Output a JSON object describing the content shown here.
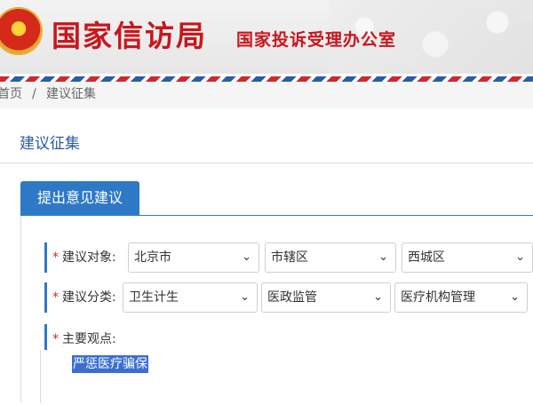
{
  "header": {
    "title": "国家信访局",
    "subtitle": "国家投诉受理办公室"
  },
  "breadcrumb": {
    "home": "首页",
    "separator": "/",
    "current": "建议征集"
  },
  "panel": {
    "title": "建议征集",
    "tab": "提出意见建议"
  },
  "form": {
    "required_mark": "*",
    "target": {
      "label": "建议对象:",
      "values": [
        "北京市",
        "市辖区",
        "西城区"
      ]
    },
    "category": {
      "label": "建议分类:",
      "values": [
        "卫生计生",
        "医政监管",
        "医疗机构管理"
      ]
    },
    "viewpoint": {
      "label": "主要观点:",
      "value": "严惩医疗骗保"
    }
  },
  "colors": {
    "brand_red": "#c8161d",
    "accent_blue": "#2e79c5",
    "required_red": "#e02020"
  }
}
